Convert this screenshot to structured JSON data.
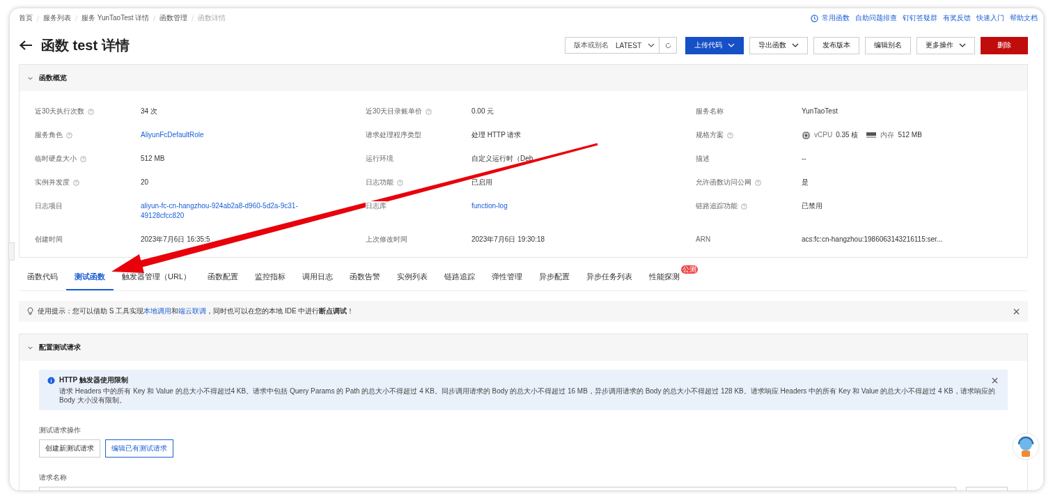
{
  "breadcrumb": [
    {
      "label": "首页",
      "current": false
    },
    {
      "label": "服务列表",
      "current": false
    },
    {
      "label": "服务 YunTaoTest 详情",
      "current": false
    },
    {
      "label": "函数管理",
      "current": false
    },
    {
      "label": "函数详情",
      "current": true
    }
  ],
  "top_links": [
    "常用函数",
    "自助问题排查",
    "钉钉答疑群",
    "有奖反馈",
    "快速入门",
    "帮助文档"
  ],
  "title": "函数 test 详情",
  "version_select": {
    "label": "版本或别名",
    "value": "LATEST"
  },
  "actions": [
    {
      "label": "上传代码",
      "kind": "primary",
      "dropdown": true
    },
    {
      "label": "导出函数",
      "kind": "default",
      "dropdown": true
    },
    {
      "label": "发布版本",
      "kind": "default",
      "dropdown": false
    },
    {
      "label": "编辑别名",
      "kind": "default",
      "dropdown": false
    },
    {
      "label": "更多操作",
      "kind": "default",
      "dropdown": true
    },
    {
      "label": "删除",
      "kind": "danger",
      "dropdown": false
    }
  ],
  "overview": {
    "title": "函数概览",
    "expanded": true,
    "items": [
      {
        "label": "近30天执行次数",
        "help": true,
        "kind": "text",
        "value": "34 次"
      },
      {
        "label": "近30天目录账单价",
        "help": true,
        "kind": "text",
        "value": "0.00 元"
      },
      {
        "label": "服务名称",
        "help": false,
        "kind": "text",
        "value": "YunTaoTest"
      },
      {
        "label": "服务角色",
        "help": true,
        "kind": "link",
        "value": "AliyunFcDefaultRole"
      },
      {
        "label": "请求处理程序类型",
        "help": false,
        "kind": "text",
        "value": "处理 HTTP 请求"
      },
      {
        "label": "规格方案",
        "help": true,
        "kind": "spec",
        "cpu_label": "vCPU",
        "cpu_value": "0.35 核",
        "mem_label": "内存",
        "mem_value": "512 MB"
      },
      {
        "label": "临时硬盘大小",
        "help": true,
        "kind": "text",
        "value": "512 MB"
      },
      {
        "label": "运行环境",
        "help": false,
        "kind": "text",
        "value": "自定义运行时（Deb"
      },
      {
        "label": "描述",
        "help": false,
        "kind": "text",
        "value": "--"
      },
      {
        "label": "实例并发度",
        "help": true,
        "kind": "text",
        "value": "20"
      },
      {
        "label": "日志功能",
        "help": true,
        "kind": "text",
        "value": "已启用"
      },
      {
        "label": "允许函数访问公网",
        "help": true,
        "kind": "text",
        "value": "是"
      },
      {
        "label": "日志项目",
        "help": false,
        "kind": "link",
        "value": "aliyun-fc-cn-hangzhou-924ab2a8-d960-5d2a-9c31-49128cfcc820"
      },
      {
        "label": "日志库",
        "help": false,
        "kind": "link",
        "value": "function-log"
      },
      {
        "label": "链路追踪功能",
        "help": true,
        "kind": "text",
        "value": "已禁用"
      },
      {
        "label": "创建时间",
        "help": false,
        "kind": "text",
        "value": "2023年7月6日 16:35:5"
      },
      {
        "label": "上次修改时间",
        "help": false,
        "kind": "text",
        "value": "2023年7月6日 19:30:18"
      },
      {
        "label": "ARN",
        "help": false,
        "kind": "text",
        "value": "acs:fc:cn-hangzhou:1986063143216115:ser..."
      }
    ]
  },
  "tabs": [
    {
      "label": "函数代码",
      "selected": false
    },
    {
      "label": "测试函数",
      "selected": true
    },
    {
      "label": "触发器管理（URL）",
      "selected": false
    },
    {
      "label": "函数配置",
      "selected": false
    },
    {
      "label": "监控指标",
      "selected": false
    },
    {
      "label": "调用日志",
      "selected": false
    },
    {
      "label": "函数告警",
      "selected": false
    },
    {
      "label": "实例列表",
      "selected": false
    },
    {
      "label": "链路追踪",
      "selected": false
    },
    {
      "label": "弹性管理",
      "selected": false
    },
    {
      "label": "异步配置",
      "selected": false
    },
    {
      "label": "异步任务列表",
      "selected": false
    },
    {
      "label": "性能探测",
      "selected": false,
      "badge": "公测"
    }
  ],
  "tip": [
    {
      "kind": "plain",
      "text": "使用提示：您可以借助 S 工具实现"
    },
    {
      "kind": "link",
      "text": "本地调用"
    },
    {
      "kind": "plain",
      "text": "和"
    },
    {
      "kind": "link",
      "text": "端云联调"
    },
    {
      "kind": "plain",
      "text": "，同时也可以在您的本地 IDE 中进行**断点调试**！"
    }
  ],
  "config": {
    "title": "配置测试请求",
    "expanded": true,
    "notice": {
      "title": "HTTP 触发器使用限制",
      "text": "请求 Headers 中的所有 Key 和 Value 的总大小不得超过4 KB。请求中包括 Query Params 的 Path 的总大小不得超过 4 KB。同步调用请求的 Body 的总大小不得超过 16 MB，异步调用请求的 Body 的总大小不得超过 128 KB。请求响应 Headers 中的所有 Key 和 Value 的总大小不得超过 4 KB，请求响应的 Body 大小没有限制。"
    },
    "ops_label": "测试请求操作",
    "ops": [
      {
        "label": "创建新测试请求",
        "selected": false
      },
      {
        "label": "编辑已有测试请求",
        "selected": true
      }
    ],
    "name_label": "请求名称"
  }
}
